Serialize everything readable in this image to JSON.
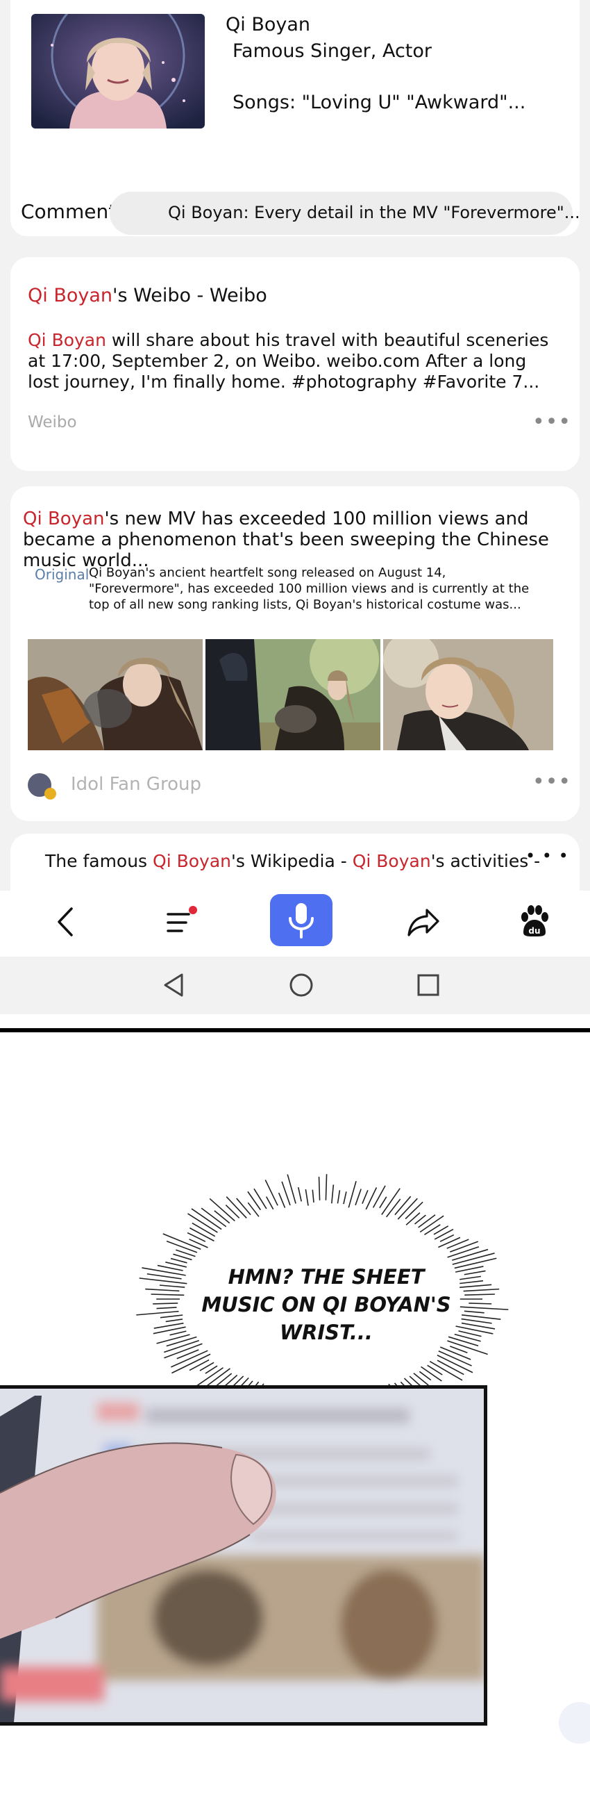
{
  "profile": {
    "name": "Qi Boyan",
    "role": "Famous Singer, Actor",
    "songs": "Songs: \"Loving U\" \"Awkward\"..."
  },
  "comment": {
    "label": "Comment",
    "text": "Qi Boyan: Every detail in the MV \"Forevermore\"..."
  },
  "results": [
    {
      "title_hl": "Qi Boyan",
      "title_rest": "'s Weibo - Weibo",
      "body_hl": "Qi Boyan",
      "body_rest": " will share about his travel with beautiful sceneries at 17:00, September 2, on Weibo. weibo.com After a long lost journey, I'm finally home. #photography #Favorite 7...",
      "source": "Weibo",
      "more": "•••"
    },
    {
      "title_hl": "Qi Boyan",
      "title_rest": "'s new MV has exceeded 100 million views and became a phenomenon that's been sweeping the Chinese music world...",
      "original_tag": "Original",
      "original_text": "Qi Boyan's ancient heartfelt song released on August 14, \"Forevermore\", has exceeded 100 million views and is currently at the top of all new song ranking lists, Qi Boyan's historical costume was...",
      "source": "Idol Fan Group",
      "more": "•••"
    },
    {
      "title_pre": "The famous ",
      "title_hl1": "Qi Boyan",
      "title_mid": "'s Wikipedia - ",
      "title_hl2": "Qi Boyan",
      "title_post": "'s activities -",
      "more": "• • •"
    }
  ],
  "navbar": {
    "icons": [
      "back-icon",
      "menu-icon",
      "microphone-icon",
      "share-icon",
      "paw-icon"
    ],
    "paw_label": "du",
    "accent_color": "#4d6ff0",
    "notification_color": "#e0283a"
  },
  "system_nav": [
    "back-triangle-icon",
    "home-circle-icon",
    "recents-square-icon"
  ],
  "comic": {
    "bubble_lines": [
      "HMN? THE SHEET",
      "MUSIC ON QI BOYAN'S",
      "WRIST..."
    ]
  }
}
